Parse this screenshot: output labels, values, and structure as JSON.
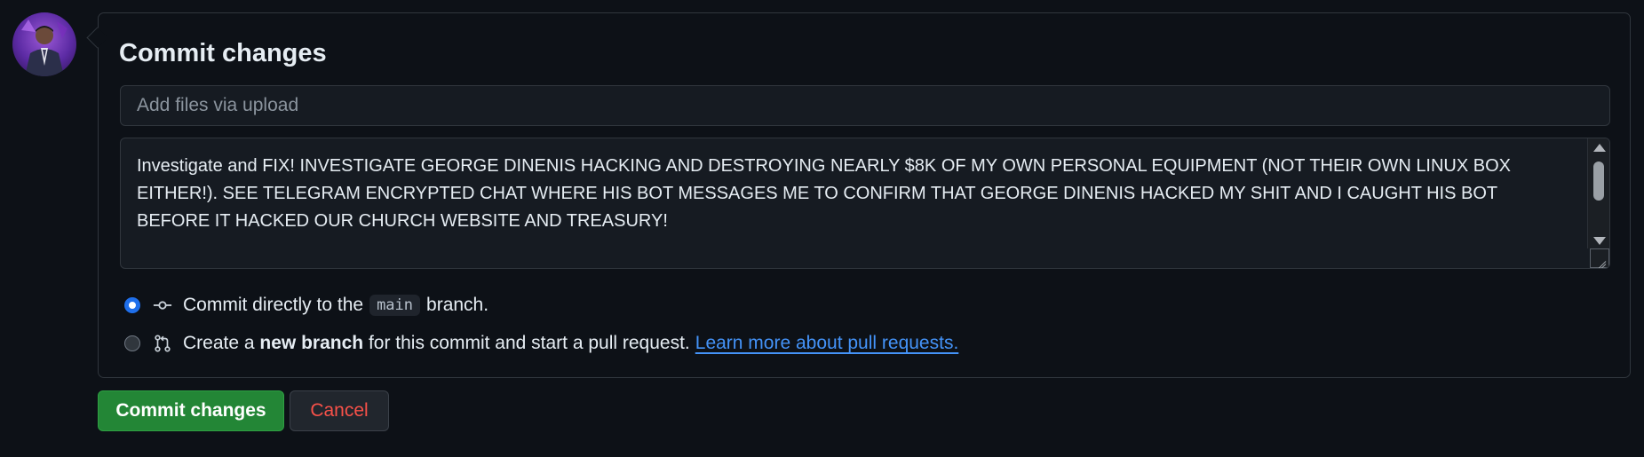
{
  "user": {
    "avatar_icon": "user-avatar-icon"
  },
  "commit": {
    "title": "Commit changes",
    "summary_placeholder": "Add files via upload",
    "description": "Investigate and FIX! INVESTIGATE GEORGE DINENIS HACKING AND DESTROYING NEARLY $8K OF MY OWN PERSONAL EQUIPMENT (NOT THEIR OWN LINUX BOX EITHER!). SEE TELEGRAM ENCRYPTED CHAT WHERE HIS BOT MESSAGES ME TO CONFIRM THAT GEORGE DINENIS HACKED MY SHIT AND I CAUGHT HIS BOT BEFORE IT HACKED OUR CHURCH WEBSITE AND TREASURY!"
  },
  "options": {
    "direct": {
      "prefix": "Commit directly to the",
      "branch": "main",
      "suffix": "branch.",
      "selected": true,
      "icon": "git-commit-icon"
    },
    "new_branch": {
      "prefix": "Create a",
      "bold": "new branch",
      "suffix": "for this commit and start a pull request.",
      "link": "Learn more about pull requests.",
      "selected": false,
      "icon": "git-pull-request-icon"
    }
  },
  "buttons": {
    "commit": "Commit changes",
    "cancel": "Cancel"
  },
  "colors": {
    "background": "#0d1117",
    "primary_button": "#238636",
    "danger_text": "#f85149",
    "link": "#4493f8",
    "radio_selected": "#1f6feb"
  }
}
